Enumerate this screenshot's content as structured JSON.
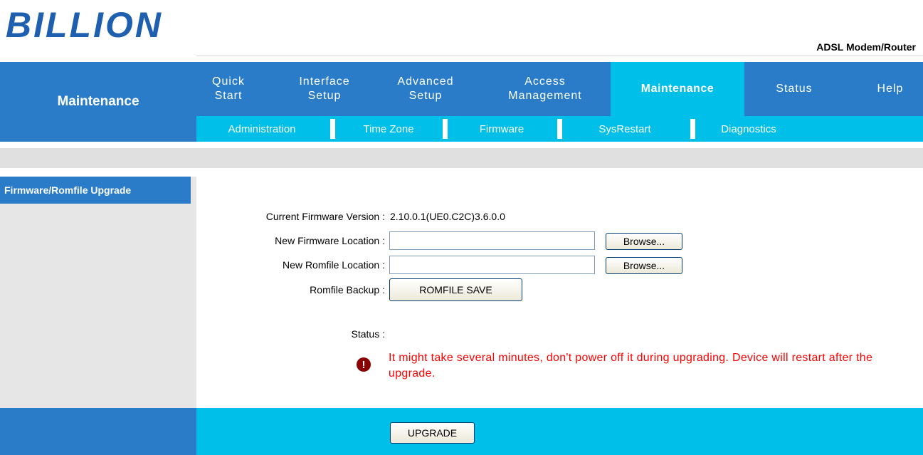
{
  "header": {
    "logo_text": "BILLION",
    "product_name": "ADSL Modem/Router"
  },
  "section_title": "Maintenance",
  "main_nav": [
    {
      "line1": "Quick",
      "line2": "Start"
    },
    {
      "line1": "Interface",
      "line2": "Setup"
    },
    {
      "line1": "Advanced",
      "line2": "Setup"
    },
    {
      "line1": "Access",
      "line2": "Management"
    },
    {
      "line1": "Maintenance",
      "line2": ""
    },
    {
      "line1": "Status",
      "line2": ""
    },
    {
      "line1": "Help",
      "line2": ""
    }
  ],
  "sub_nav": [
    "Administration",
    "Time Zone",
    "Firmware",
    "SysRestart",
    "Diagnostics"
  ],
  "left_panel_title": "Firmware/Romfile Upgrade",
  "form": {
    "current_fw_label": "Current Firmware Version :",
    "current_fw_value": "2.10.0.1(UE0.C2C)3.6.0.0",
    "new_fw_label": "New Firmware Location :",
    "new_fw_value": "",
    "new_romfile_label": "New Romfile Location :",
    "new_romfile_value": "",
    "browse_label": "Browse...",
    "romfile_backup_label": "Romfile Backup :",
    "romfile_save_label": "ROMFILE SAVE",
    "status_label": "Status :",
    "warning_icon_glyph": "!",
    "warning_text": "It might take several minutes, don't power off it during upgrading. Device will restart after the upgrade."
  },
  "upgrade_button": "UPGRADE",
  "colors": {
    "dark_blue": "#2a7cc8",
    "light_blue": "#00bfe8",
    "warning_red": "#ff0000"
  },
  "icons": {
    "warning": "exclamation-circle-icon"
  }
}
